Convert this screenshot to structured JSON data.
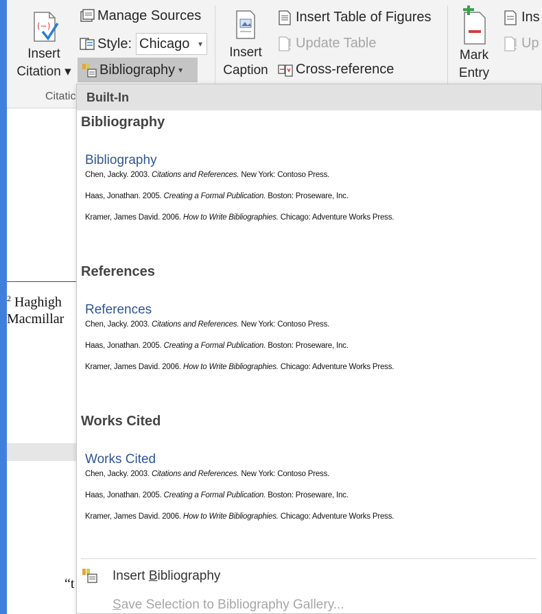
{
  "ribbon": {
    "insert_citation": [
      "Insert",
      "Citation ▾"
    ],
    "manage_sources": "Manage Sources",
    "style_label": "Style:",
    "style_value": "Chicago",
    "bibliography_button": "Bibliography",
    "group_label": "Citatic",
    "insert_caption": [
      "Insert",
      "Caption"
    ],
    "insert_table_of_figures": "Insert Table of Figures",
    "update_table": "Update Table",
    "cross_reference": "Cross-reference",
    "mark_entry": [
      "Mark",
      "Entry"
    ],
    "insert_index": "Ins",
    "update_index": "Up"
  },
  "document": {
    "footnote_line1": "Haghigh",
    "footnote_num": "2",
    "footnote_line2": "Macmillar",
    "quote_text": "“t"
  },
  "dropdown": {
    "header": "Built-In",
    "sections": [
      {
        "title": "Bibliography",
        "heading": "Bibliography",
        "entries": [
          {
            "prefix": "Chen, Jacky. 2003. ",
            "italic": "Citations and References.",
            "suffix": " New York: Contoso Press."
          },
          {
            "prefix": "Haas, Jonathan. 2005. ",
            "italic": "Creating a Formal Publication.",
            "suffix": " Boston: Proseware, Inc."
          },
          {
            "prefix": "Kramer, James David. 2006. ",
            "italic": "How to Write Bibliographies.",
            "suffix": " Chicago: Adventure Works Press."
          }
        ]
      },
      {
        "title": "References",
        "heading": "References",
        "entries": [
          {
            "prefix": "Chen, Jacky. 2003. ",
            "italic": "Citations and References.",
            "suffix": " New York: Contoso Press."
          },
          {
            "prefix": "Haas, Jonathan. 2005. ",
            "italic": "Creating a Formal Publication.",
            "suffix": " Boston: Proseware, Inc."
          },
          {
            "prefix": "Kramer, James David. 2006. ",
            "italic": "How to Write Bibliographies.",
            "suffix": " Chicago: Adventure Works Press."
          }
        ]
      },
      {
        "title": "Works Cited",
        "heading": "Works Cited",
        "entries": [
          {
            "prefix": "Chen, Jacky. 2003. ",
            "italic": "Citations and References.",
            "suffix": " New York: Contoso Press."
          },
          {
            "prefix": "Haas, Jonathan. 2005. ",
            "italic": "Creating a Formal Publication.",
            "suffix": " Boston: Proseware, Inc."
          },
          {
            "prefix": "Kramer, James David. 2006. ",
            "italic": "How to Write Bibliographies.",
            "suffix": " Chicago: Adventure Works Press."
          }
        ]
      }
    ],
    "insert_bibliography": {
      "pre": "Insert ",
      "accel": "B",
      "post": "ibliography"
    },
    "save_selection": {
      "accel": "S",
      "post": "ave Selection to Bibliography Gallery..."
    }
  },
  "colors": {
    "window_frame": "#3f7fe0",
    "gallery_heading": "#2e5597",
    "ribbon_bg": "#f3f3f3",
    "pressed_button": "#c5c5c5"
  },
  "icons": [
    "insert-citation-icon",
    "manage-sources-icon",
    "style-icon",
    "bibliography-icon",
    "insert-caption-icon",
    "table-of-figures-icon",
    "update-table-icon",
    "cross-reference-icon",
    "mark-entry-icon",
    "insert-index-icon",
    "update-index-icon"
  ]
}
